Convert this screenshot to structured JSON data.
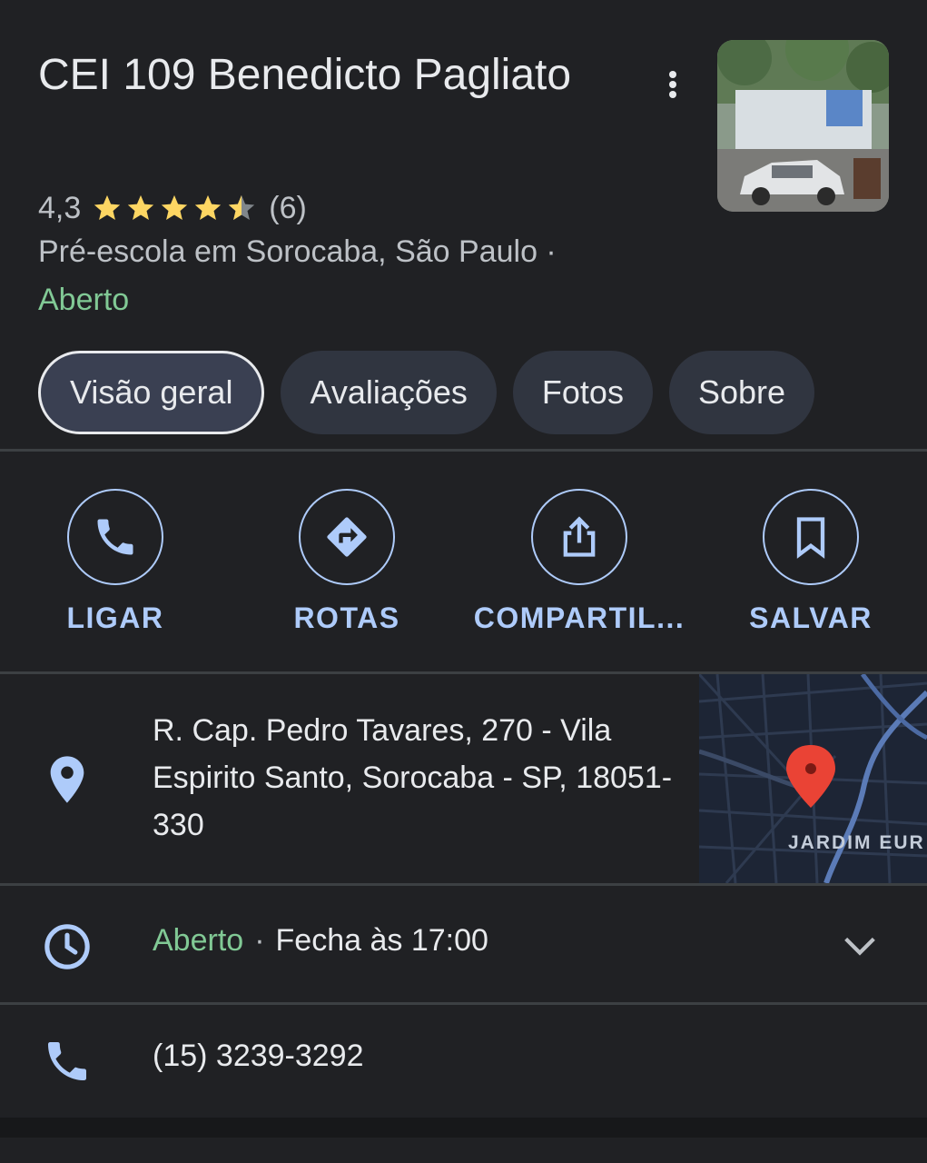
{
  "place": {
    "title": "CEI 109 Benedicto Pagliato",
    "rating": "4,3",
    "stars": 4.3,
    "review_count": "(6)",
    "category": "Pré-escola em Sorocaba, São Paulo ·",
    "status": "Aberto"
  },
  "tabs": [
    {
      "label": "Visão geral",
      "active": true
    },
    {
      "label": "Avaliações",
      "active": false
    },
    {
      "label": "Fotos",
      "active": false
    },
    {
      "label": "Sobre",
      "active": false
    }
  ],
  "actions": [
    {
      "label": "LIGAR",
      "icon": "phone-icon"
    },
    {
      "label": "ROTAS",
      "icon": "directions-icon"
    },
    {
      "label": "COMPARTIL...",
      "icon": "share-icon"
    },
    {
      "label": "SALVAR",
      "icon": "bookmark-icon"
    }
  ],
  "address": {
    "text": "R. Cap. Pedro Tavares, 270 - Vila Espirito Santo, Sorocaba - SP, 18051-330",
    "icon": "location-pin-icon",
    "map_label": "JARDIM EUR"
  },
  "hours": {
    "status": "Aberto",
    "separator": "·",
    "closes": "Fecha às 17:00",
    "icon": "clock-icon"
  },
  "phone": {
    "number": "(15) 3239-3292",
    "icon": "phone-icon"
  },
  "colors": {
    "background": "#202124",
    "accent": "#aecbfa",
    "open_green": "#81c995",
    "star_yellow": "#fdd663",
    "pin_red": "#ea4335"
  }
}
